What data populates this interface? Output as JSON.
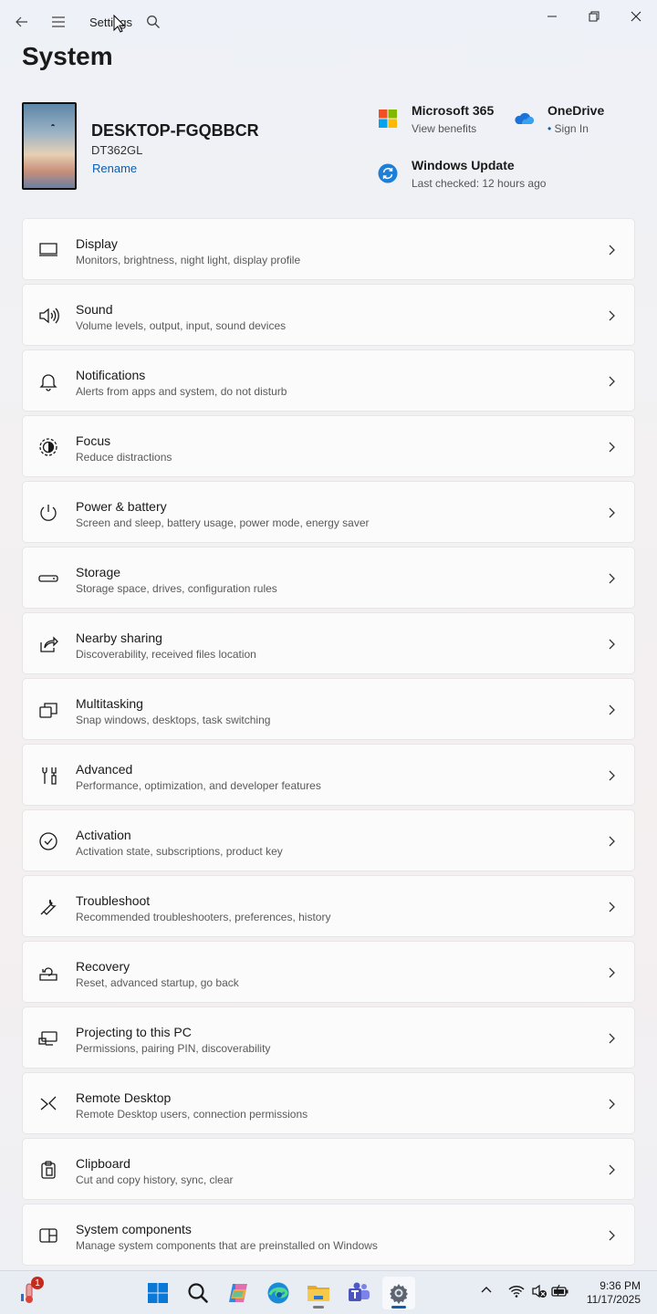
{
  "titlebar": {
    "title": "Settings"
  },
  "page": {
    "title": "System"
  },
  "device": {
    "name": "DESKTOP-FGQBBCR",
    "model": "DT362GL",
    "rename_label": "Rename"
  },
  "promos": {
    "m365": {
      "title": "Microsoft 365",
      "subtitle": "View benefits"
    },
    "onedrive": {
      "title": "OneDrive",
      "subtitle": "Sign In"
    },
    "update": {
      "title": "Windows Update",
      "subtitle": "Last checked: 12 hours ago"
    }
  },
  "settings_items": [
    {
      "title": "Display",
      "subtitle": "Monitors, brightness, night light, display profile",
      "icon": "display-icon"
    },
    {
      "title": "Sound",
      "subtitle": "Volume levels, output, input, sound devices",
      "icon": "speaker-icon"
    },
    {
      "title": "Notifications",
      "subtitle": "Alerts from apps and system, do not disturb",
      "icon": "bell-icon"
    },
    {
      "title": "Focus",
      "subtitle": "Reduce distractions",
      "icon": "focus-icon"
    },
    {
      "title": "Power & battery",
      "subtitle": "Screen and sleep, battery usage, power mode, energy saver",
      "icon": "power-icon"
    },
    {
      "title": "Storage",
      "subtitle": "Storage space, drives, configuration rules",
      "icon": "storage-icon"
    },
    {
      "title": "Nearby sharing",
      "subtitle": "Discoverability, received files location",
      "icon": "share-icon"
    },
    {
      "title": "Multitasking",
      "subtitle": "Snap windows, desktops, task switching",
      "icon": "multitasking-icon"
    },
    {
      "title": "Advanced",
      "subtitle": "Performance, optimization, and developer features",
      "icon": "advanced-icon"
    },
    {
      "title": "Activation",
      "subtitle": "Activation state, subscriptions, product key",
      "icon": "checkmark-circle-icon"
    },
    {
      "title": "Troubleshoot",
      "subtitle": "Recommended troubleshooters, preferences, history",
      "icon": "wrench-icon"
    },
    {
      "title": "Recovery",
      "subtitle": "Reset, advanced startup, go back",
      "icon": "recovery-icon"
    },
    {
      "title": "Projecting to this PC",
      "subtitle": "Permissions, pairing PIN, discoverability",
      "icon": "projecting-icon"
    },
    {
      "title": "Remote Desktop",
      "subtitle": "Remote Desktop users, connection permissions",
      "icon": "remote-desktop-icon"
    },
    {
      "title": "Clipboard",
      "subtitle": "Cut and copy history, sync, clear",
      "icon": "clipboard-icon"
    },
    {
      "title": "System components",
      "subtitle": "Manage system components that are preinstalled on Windows",
      "icon": "components-icon"
    }
  ],
  "taskbar": {
    "notification_badge": "1",
    "time": "9:36 PM",
    "date": "11/17/2025"
  },
  "colors": {
    "accent": "#0a5fb4",
    "badge": "#c42b1c"
  }
}
